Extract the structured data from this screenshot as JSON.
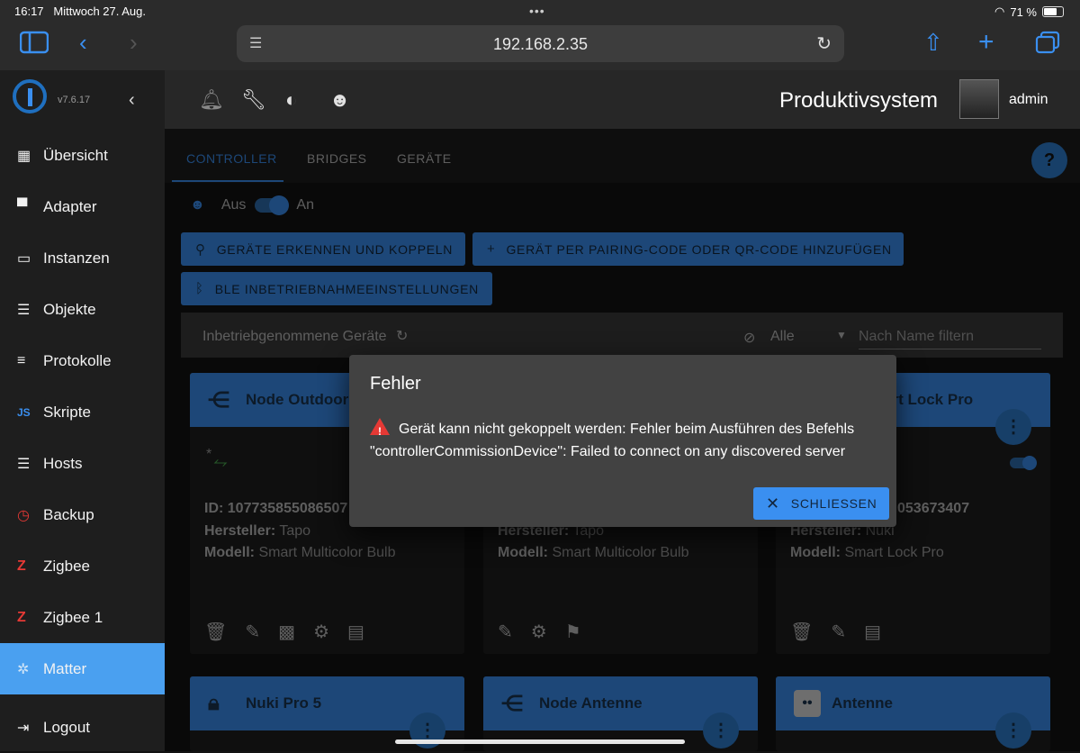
{
  "status": {
    "time": "16:17",
    "date": "Mittwoch 27. Aug.",
    "battery": "71 %",
    "battery_level": 0.71
  },
  "browser": {
    "url": "192.168.2.35"
  },
  "sidebar": {
    "version": "v7.6.17",
    "items": [
      {
        "label": "Übersicht",
        "icon": "grid-icon"
      },
      {
        "label": "Adapter",
        "icon": "store-icon"
      },
      {
        "label": "Instanzen",
        "icon": "instances-icon"
      },
      {
        "label": "Objekte",
        "icon": "list-icon"
      },
      {
        "label": "Protokolle",
        "icon": "log-icon"
      },
      {
        "label": "Skripte",
        "icon": "js-icon"
      },
      {
        "label": "Hosts",
        "icon": "server-icon"
      },
      {
        "label": "Backup",
        "icon": "backup-icon"
      },
      {
        "label": "Zigbee",
        "icon": "zigbee-icon"
      },
      {
        "label": "Zigbee 1",
        "icon": "zigbee-icon"
      },
      {
        "label": "Matter",
        "icon": "matter-icon"
      },
      {
        "label": "Logout",
        "icon": "logout-icon"
      }
    ]
  },
  "header": {
    "title": "Produktivsystem",
    "user": "admin"
  },
  "tabs": [
    "CONTROLLER",
    "BRIDGES",
    "GERÄTE"
  ],
  "controller": {
    "off_label": "Aus",
    "on_label": "An"
  },
  "buttons": {
    "discover": "GERÄTE ERKENNEN UND KOPPELN",
    "add_code": "GERÄT PER PAIRING-CODE ODER QR-CODE HINZUFÜGEN",
    "ble": "BLE INBETRIEBNAHMEEINSTELLUNGEN"
  },
  "filter": {
    "title": "Inbetriebgenommene Geräte",
    "select_value": "Alle",
    "search_placeholder": "Nach Name filtern"
  },
  "cards": [
    {
      "name": "Node Outdoorl",
      "id": "ID: 107735855086507",
      "vendor_label": "Hersteller:",
      "vendor": "Tapo",
      "model_label": "Modell:",
      "model": "Smart Multicolor Bulb"
    },
    {
      "name": "",
      "vendor_label": "Hersteller:",
      "vendor": "Tapo",
      "model_label": "Modell:",
      "model": "Smart Multicolor Bulb"
    },
    {
      "name": "art Lock Pro",
      "id": "053673407",
      "vendor_label": "Hersteller:",
      "vendor": "Nuki",
      "model_label": "Modell:",
      "model": "Smart Lock Pro"
    },
    {
      "name": "Nuki Pro 5"
    },
    {
      "name": "Node Antenne"
    },
    {
      "name": "Antenne"
    }
  ],
  "dialog": {
    "title": "Fehler",
    "message": "Gerät kann nicht gekoppelt werden: Fehler beim Ausführen des Befehls \"controllerCommissionDevice\": Failed to connect on any discovered server",
    "close_label": "SCHLIESSEN"
  }
}
